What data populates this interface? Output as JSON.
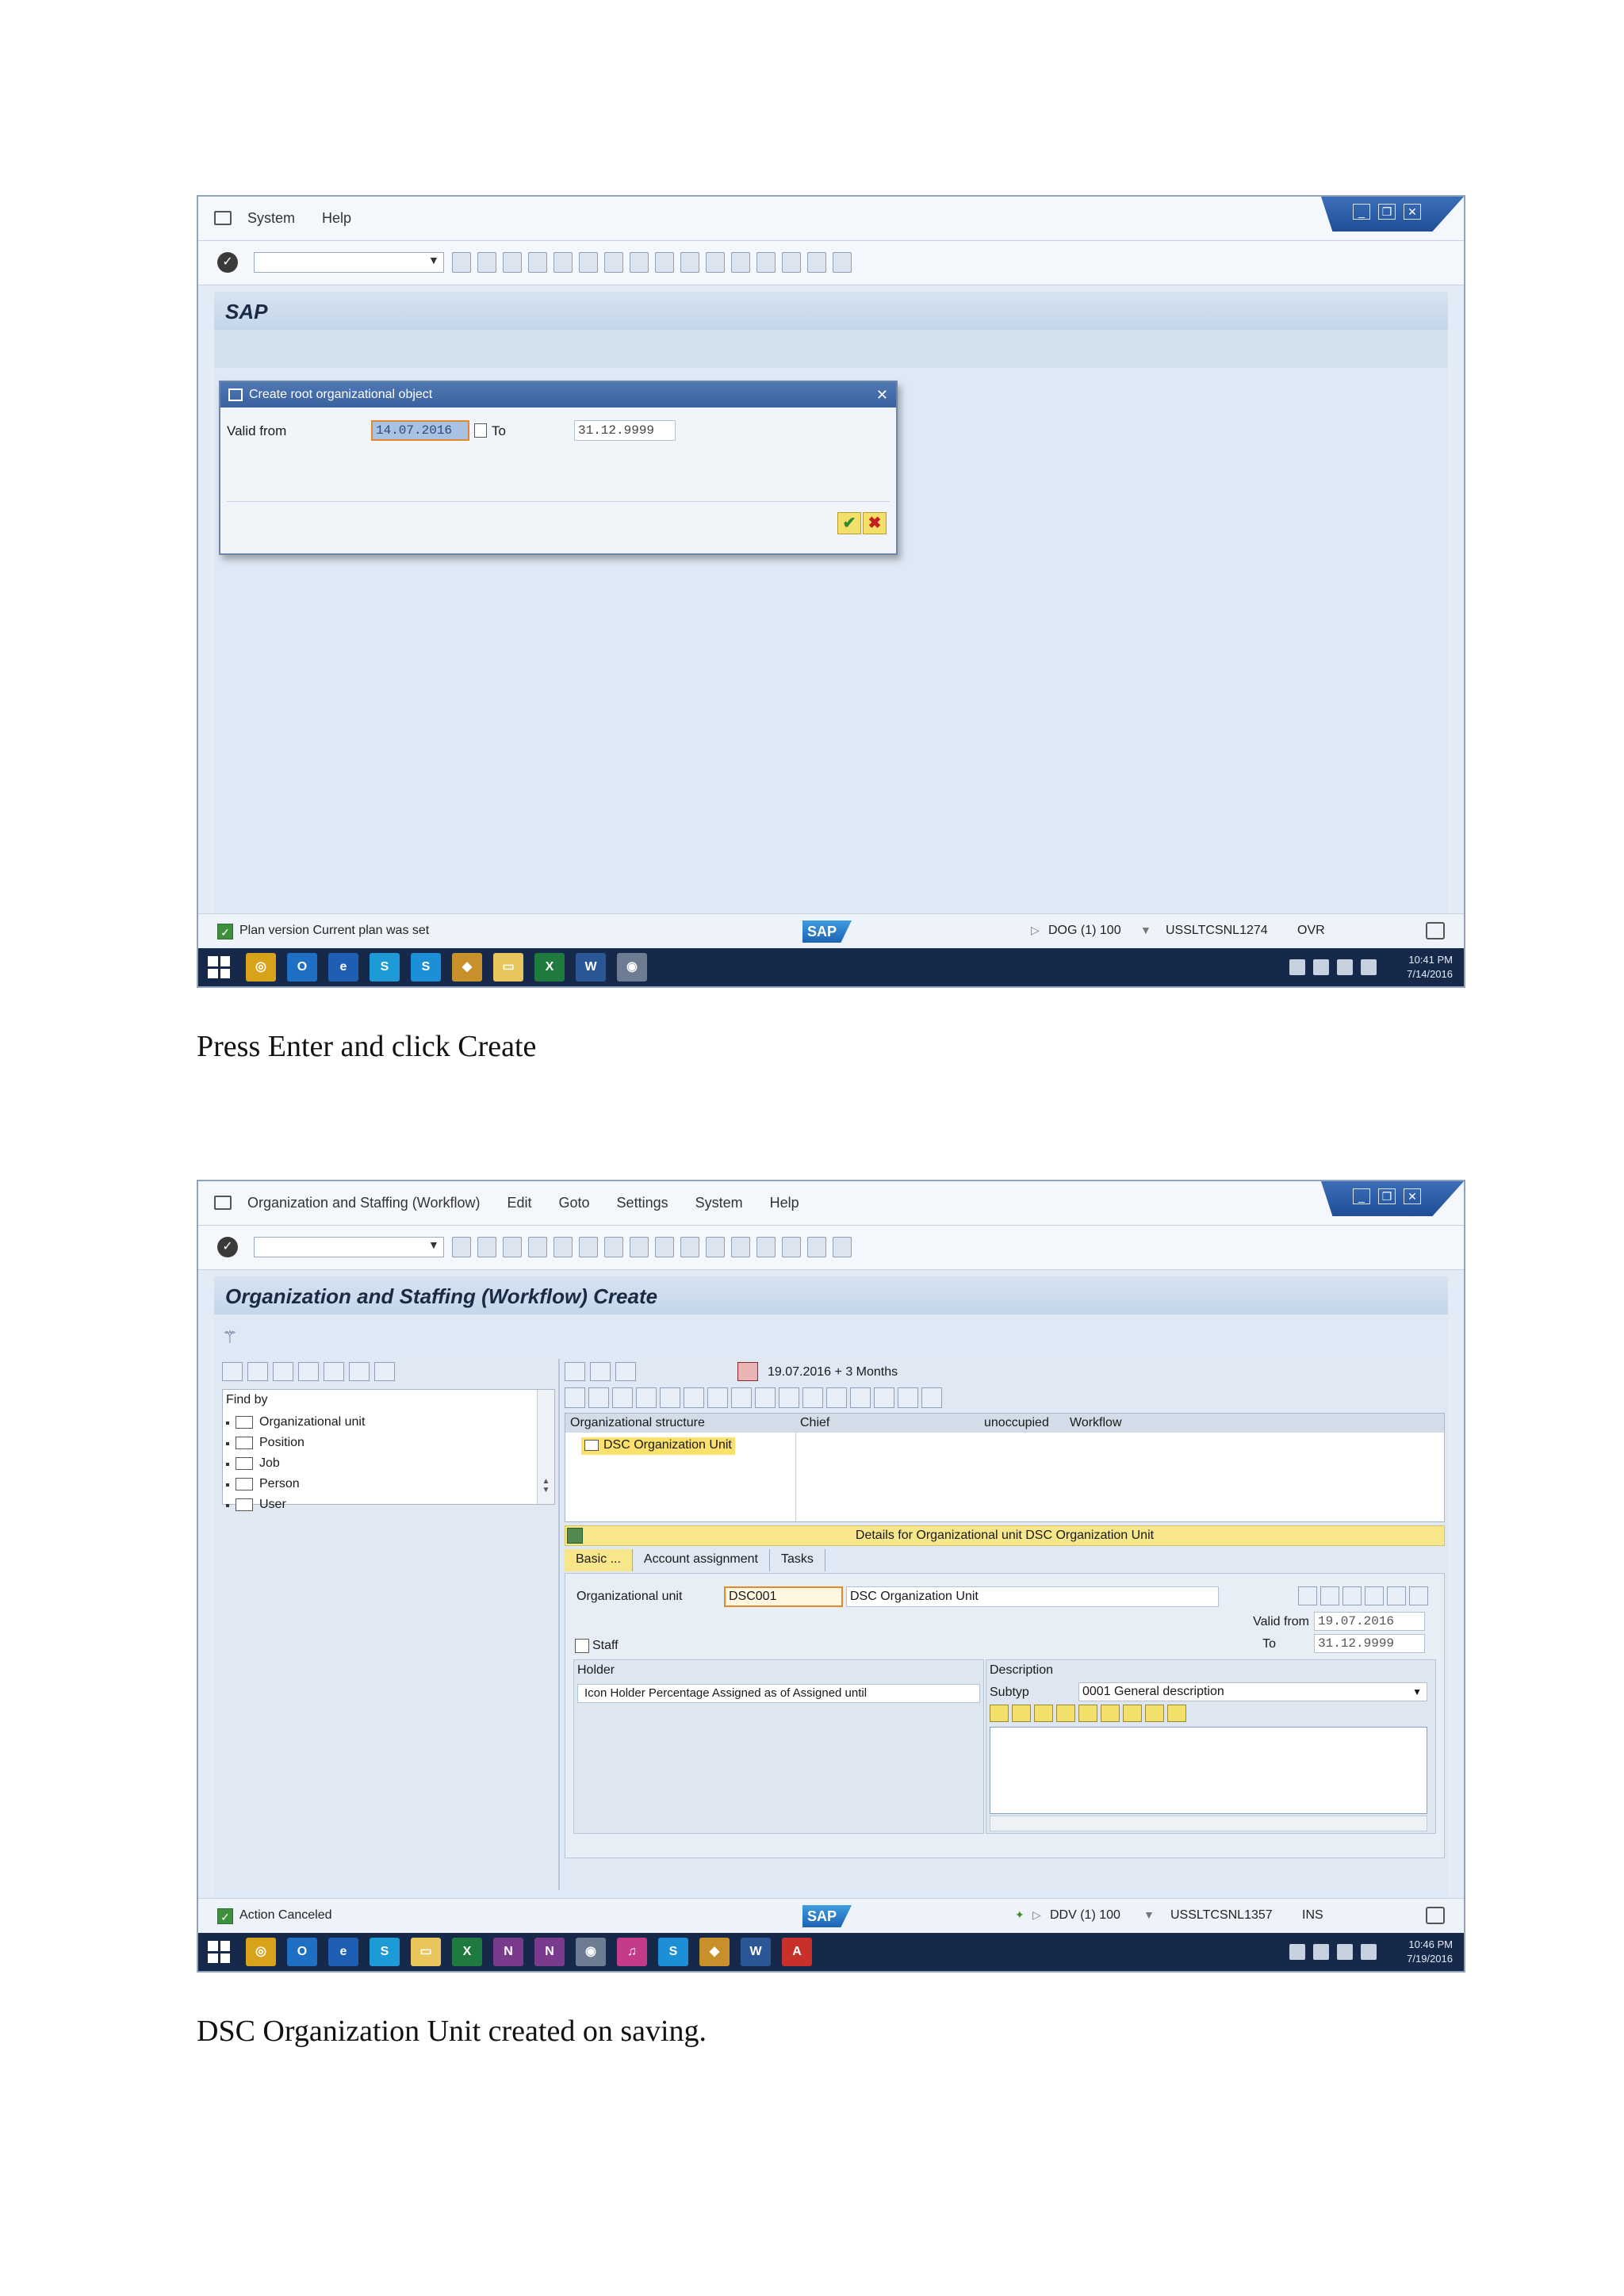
{
  "shot1": {
    "menu": [
      "System",
      "Help"
    ],
    "title": "SAP",
    "dialog": {
      "title": "Create root organizational object",
      "valid_from_label": "Valid from",
      "valid_from_value": "14.07.2016",
      "to_label": "To",
      "to_value": "31.12.9999"
    },
    "status": {
      "message": "Plan version Current plan was set",
      "system": "DOG (1) 100",
      "server": "USSLTCSNL1274",
      "mode": "OVR"
    },
    "clock": {
      "time": "10:41 PM",
      "date": "7/14/2016"
    }
  },
  "caption1": "Press Enter and click Create",
  "shot2": {
    "menu": [
      "Organization and Staffing (Workflow)",
      "Edit",
      "Goto",
      "Settings",
      "System",
      "Help"
    ],
    "title": "Organization and Staffing (Workflow) Create",
    "find_by": {
      "title": "Find by",
      "items": [
        "Organizational unit",
        "Position",
        "Job",
        "Person",
        "User"
      ]
    },
    "date_range": "19.07.2016 + 3 Months",
    "structure": {
      "columns": [
        "Organizational structure",
        "Chief",
        "unoccupied",
        "Workflow"
      ],
      "node": "DSC Organization Unit"
    },
    "details_title": "Details for Organizational unit DSC Organization Unit",
    "tabs": [
      "Basic ...",
      "Account assignment",
      "Tasks"
    ],
    "form": {
      "org_unit_label": "Organizational unit",
      "org_unit_code": "DSC001",
      "org_unit_name": "DSC Organization Unit",
      "valid_from_label": "Valid from",
      "valid_from_value": "19.07.2016",
      "to_label": "To",
      "to_value": "31.12.9999",
      "staff_label": "Staff",
      "holder_label": "Holder",
      "holder_columns": "Icon Holder Percentage Assigned as of Assigned until",
      "description_label": "Description",
      "subtype_label": "Subtyp",
      "subtype_value": "0001 General description"
    },
    "status": {
      "message": "Action Canceled",
      "system": "DDV (1) 100",
      "server": "USSLTCSNL1357",
      "mode": "INS"
    },
    "clock": {
      "time": "10:46 PM",
      "date": "7/19/2016"
    }
  },
  "caption2": "DSC Organization Unit created on saving."
}
